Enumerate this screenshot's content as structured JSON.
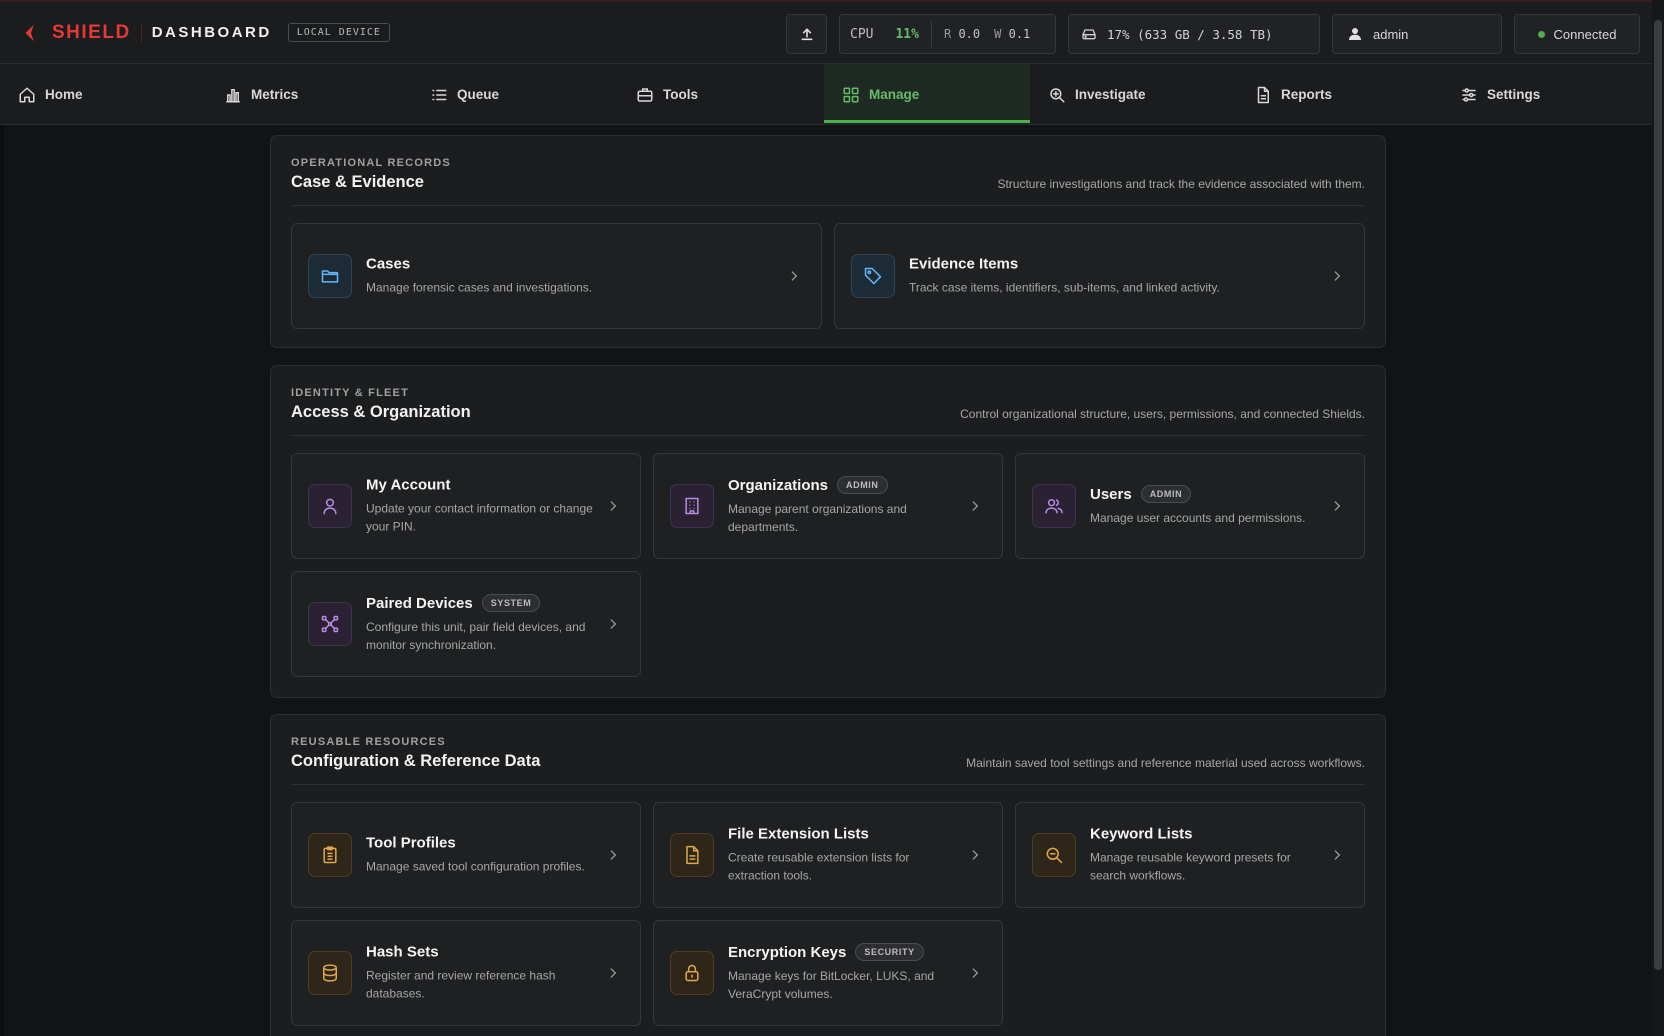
{
  "header": {
    "brand": "SHIELD",
    "subtitle": "DASHBOARD",
    "device_badge": "LOCAL DEVICE",
    "cpu_label": "CPU",
    "cpu_value": "11%",
    "read_label": "R",
    "read_value": "0.0",
    "write_label": "W",
    "write_value": "0.1",
    "disk_text": "17% (633 GB / 3.58 TB)",
    "user": "admin",
    "connection": "Connected",
    "colors": {
      "brand": "#e53935",
      "cpu_value": "#66bb6a",
      "connected_dot": "#4caf50"
    }
  },
  "nav": {
    "active": "Manage",
    "items": [
      {
        "label": "Home",
        "icon": "home-icon"
      },
      {
        "label": "Metrics",
        "icon": "bar-chart-icon"
      },
      {
        "label": "Queue",
        "icon": "list-icon"
      },
      {
        "label": "Tools",
        "icon": "briefcase-icon"
      },
      {
        "label": "Manage",
        "icon": "grid-icon"
      },
      {
        "label": "Investigate",
        "icon": "zoom-icon"
      },
      {
        "label": "Reports",
        "icon": "document-icon"
      },
      {
        "label": "Settings",
        "icon": "sliders-icon"
      }
    ],
    "active_color": "#66bb6a"
  },
  "sections": [
    {
      "eyebrow": "OPERATIONAL RECORDS",
      "title": "Case & Evidence",
      "description": "Structure investigations and track the evidence associated with them.",
      "cards": [
        {
          "title": "Cases",
          "description": "Manage forensic cases and investigations.",
          "icon": "folder-icon"
        },
        {
          "title": "Evidence Items",
          "description": "Track case items, identifiers, sub-items, and linked activity.",
          "icon": "tag-icon"
        }
      ]
    },
    {
      "eyebrow": "IDENTITY & FLEET",
      "title": "Access & Organization",
      "description": "Control organizational structure, users, permissions, and connected Shields.",
      "cards": [
        {
          "title": "My Account",
          "description": "Update your contact information or change your PIN.",
          "icon": "user-icon"
        },
        {
          "title": "Organizations",
          "badge": "ADMIN",
          "description": "Manage parent organizations and departments.",
          "icon": "building-icon"
        },
        {
          "title": "Users",
          "badge": "ADMIN",
          "description": "Manage user accounts and permissions.",
          "icon": "users-icon"
        },
        {
          "title": "Paired Devices",
          "badge": "SYSTEM",
          "description": "Configure this unit, pair field devices, and monitor synchronization.",
          "icon": "network-icon"
        }
      ]
    },
    {
      "eyebrow": "REUSABLE RESOURCES",
      "title": "Configuration & Reference Data",
      "description": "Maintain saved tool settings and reference material used across workflows.",
      "cards": [
        {
          "title": "Tool Profiles",
          "description": "Manage saved tool configuration profiles.",
          "icon": "clipboard-icon"
        },
        {
          "title": "File Extension Lists",
          "description": "Create reusable extension lists for extraction tools.",
          "icon": "file-icon"
        },
        {
          "title": "Keyword Lists",
          "description": "Manage reusable keyword presets for search workflows.",
          "icon": "search-doc-icon"
        },
        {
          "title": "Hash Sets",
          "description": "Register and review reference hash databases.",
          "icon": "database-icon"
        },
        {
          "title": "Encryption Keys",
          "badge": "SECURITY",
          "description": "Manage keys for BitLocker, LUKS, and VeraCrypt volumes.",
          "icon": "lock-icon"
        }
      ]
    }
  ]
}
